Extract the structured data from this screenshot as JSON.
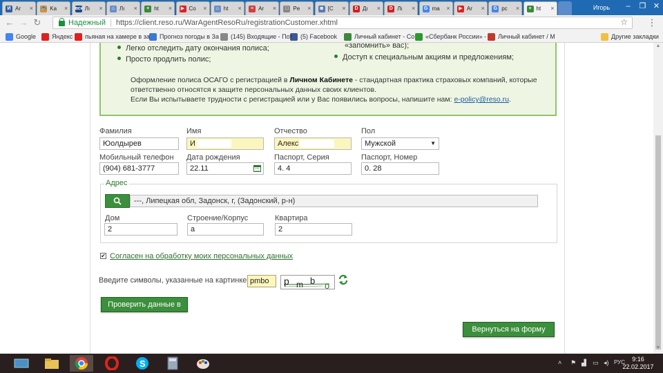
{
  "browser": {
    "tabs": [
      {
        "label": "Ar",
        "color": "#2f5fa8",
        "glyph": "И"
      },
      {
        "label": "Ka",
        "color": "#e58a2b",
        "glyph": "🐟"
      },
      {
        "label": "Лı",
        "color": "#1a4a8a",
        "glyph": "вск"
      },
      {
        "label": "Лı",
        "color": "#6a8fc9",
        "glyph": "⌂"
      },
      {
        "label": "ht",
        "color": "#3a8a3a",
        "glyph": "+"
      },
      {
        "label": "Co",
        "color": "#e02020",
        "glyph": "▶"
      },
      {
        "label": "ht",
        "color": "#6a8fc9",
        "glyph": "⌂"
      },
      {
        "label": "Ar",
        "color": "#d04040",
        "glyph": "≡"
      },
      {
        "label": "Pe",
        "color": "#888888",
        "glyph": "□"
      },
      {
        "label": "[C",
        "color": "#5b7bb5",
        "glyph": "◙"
      },
      {
        "label": "Дı",
        "color": "#cc2222",
        "glyph": "D"
      },
      {
        "label": "Лı",
        "color": "#cc2222",
        "glyph": "D"
      },
      {
        "label": "ma",
        "color": "#4285f4",
        "glyph": "G"
      },
      {
        "label": "Ar",
        "color": "#e02020",
        "glyph": "▶"
      },
      {
        "label": "pc",
        "color": "#4285f4",
        "glyph": "G"
      },
      {
        "label": "ht",
        "color": "#3a8a3a",
        "glyph": "+"
      }
    ],
    "active_tab": 15,
    "user": "Игорь",
    "secure_label": "Надежный",
    "url": "https://client.reso.ru/WarAgentResoRu/registrationCustomer.xhtml",
    "bookmarks": [
      {
        "label": "Google",
        "color": "#4285f4"
      },
      {
        "label": "Яндекс",
        "color": "#e02020"
      },
      {
        "label": "пьяная на хамере в за",
        "color": "#e02020"
      },
      {
        "label": "Прогноз погоды в За",
        "color": "#3a7ad0"
      },
      {
        "label": "(145) Входящие - Пот",
        "color": "#888888"
      },
      {
        "label": "(5) Facebook",
        "color": "#3b5998"
      },
      {
        "label": "Личный кабинет - Со",
        "color": "#3a8a3a"
      },
      {
        "label": "«Сбербанк России» -",
        "color": "#2a9a2a"
      },
      {
        "label": "Личный кабинет / М",
        "color": "#c0392b"
      }
    ],
    "other_bookmarks": "Другие закладки"
  },
  "info": {
    "bullets_left": [
      "Легко отследить дату окончания полиса;",
      "Просто продлить полис;"
    ],
    "bullets_right_top": "«запомнить» вас);",
    "bullets_right": [
      "Доступ к специальным акциям и предложениям;"
    ],
    "note_pre": "Оформление полиса ОСАГО с регистрацией в ",
    "note_bold": "Личном Кабинете",
    "note_post": " - стандартная практика страховых компаний, которые ответственно относятся к защите персональных данных своих клиентов.",
    "note_line2": "Если Вы испытываете трудности с регистрацией или у Вас появились вопросы, напишите нам: ",
    "email": "e-policy@reso.ru",
    "note_end": "."
  },
  "form": {
    "surname_label": "Фамилия",
    "surname": "Юолдырев",
    "name_label": "Имя",
    "name": "И",
    "patronymic_label": "Отчество",
    "patronymic": "Алекс",
    "gender_label": "Пол",
    "gender": "Мужской",
    "phone_label": "Мобильный телефон",
    "phone": "(904) 681-3777",
    "dob_label": "Дата рождения",
    "dob": "22.11",
    "pass_series_label": "Паспорт, Серия",
    "pass_series": "4.   4",
    "pass_number_label": "Паспорт, Номер",
    "pass_number": "0.    28",
    "address_legend": "Адрес",
    "address": "---, Липецкая обл, Задонск, г, (Задонский, р-н)",
    "house_label": "Дом",
    "house": "2",
    "building_label": "Строение/Корпус",
    "building": "а",
    "flat_label": "Квартира",
    "flat": "2",
    "consent_checked": "✔",
    "consent": "Согласен на обработку моих персональных данных",
    "captcha_label": "Введите символы, указанные на картинке:",
    "captcha_value": "pmbo",
    "captcha_chars": [
      "p",
      "m",
      "b",
      "o"
    ],
    "check_btn": "Проверить данные в РСА",
    "back_btn": "Вернуться на форму входа"
  },
  "taskbar": {
    "lang": "РУС",
    "time": "9:16",
    "date": "22.02.2017"
  }
}
